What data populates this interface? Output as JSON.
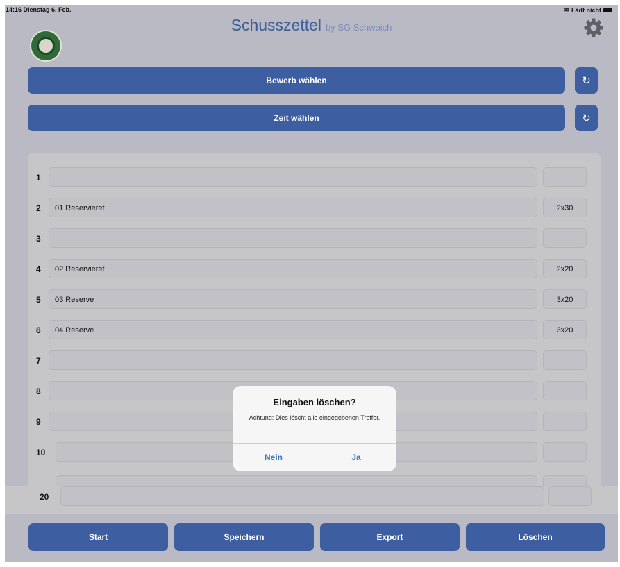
{
  "status": {
    "time_date": "14:16  Dienstag 6. Feb.",
    "charging": "Lädt nicht"
  },
  "header": {
    "title": "Schusszettel",
    "subtitle": "by SG Schwoich"
  },
  "buttons": {
    "bewerb": "Bewerb wählen",
    "zeit": "Zeit wählen",
    "reset_icon": "↻"
  },
  "rows": [
    {
      "num": "1",
      "name": "",
      "count": ""
    },
    {
      "num": "2",
      "name": "01 Reservieret",
      "count": "2x30"
    },
    {
      "num": "3",
      "name": "",
      "count": ""
    },
    {
      "num": "4",
      "name": "02 Reservieret",
      "count": "2x20"
    },
    {
      "num": "5",
      "name": "03 Reserve",
      "count": "3x20"
    },
    {
      "num": "6",
      "name": "04 Reserve",
      "count": "3x20"
    },
    {
      "num": "7",
      "name": "",
      "count": ""
    },
    {
      "num": "8",
      "name": "",
      "count": ""
    },
    {
      "num": "9",
      "name": "",
      "count": ""
    },
    {
      "num": "10",
      "name": "",
      "count": ""
    }
  ],
  "row20": {
    "num": "20"
  },
  "footer": {
    "start": "Start",
    "save": "Speichern",
    "export": "Export",
    "delete": "Löschen"
  },
  "dialog": {
    "title": "Eingaben löschen?",
    "message": "Achtung: Dies löscht alle eingegebenen Treffer.",
    "no": "Nein",
    "yes": "Ja"
  },
  "colors": {
    "accent": "#3d5ea0",
    "background": "#b9bac4",
    "dialog_link": "#3a78c8"
  }
}
